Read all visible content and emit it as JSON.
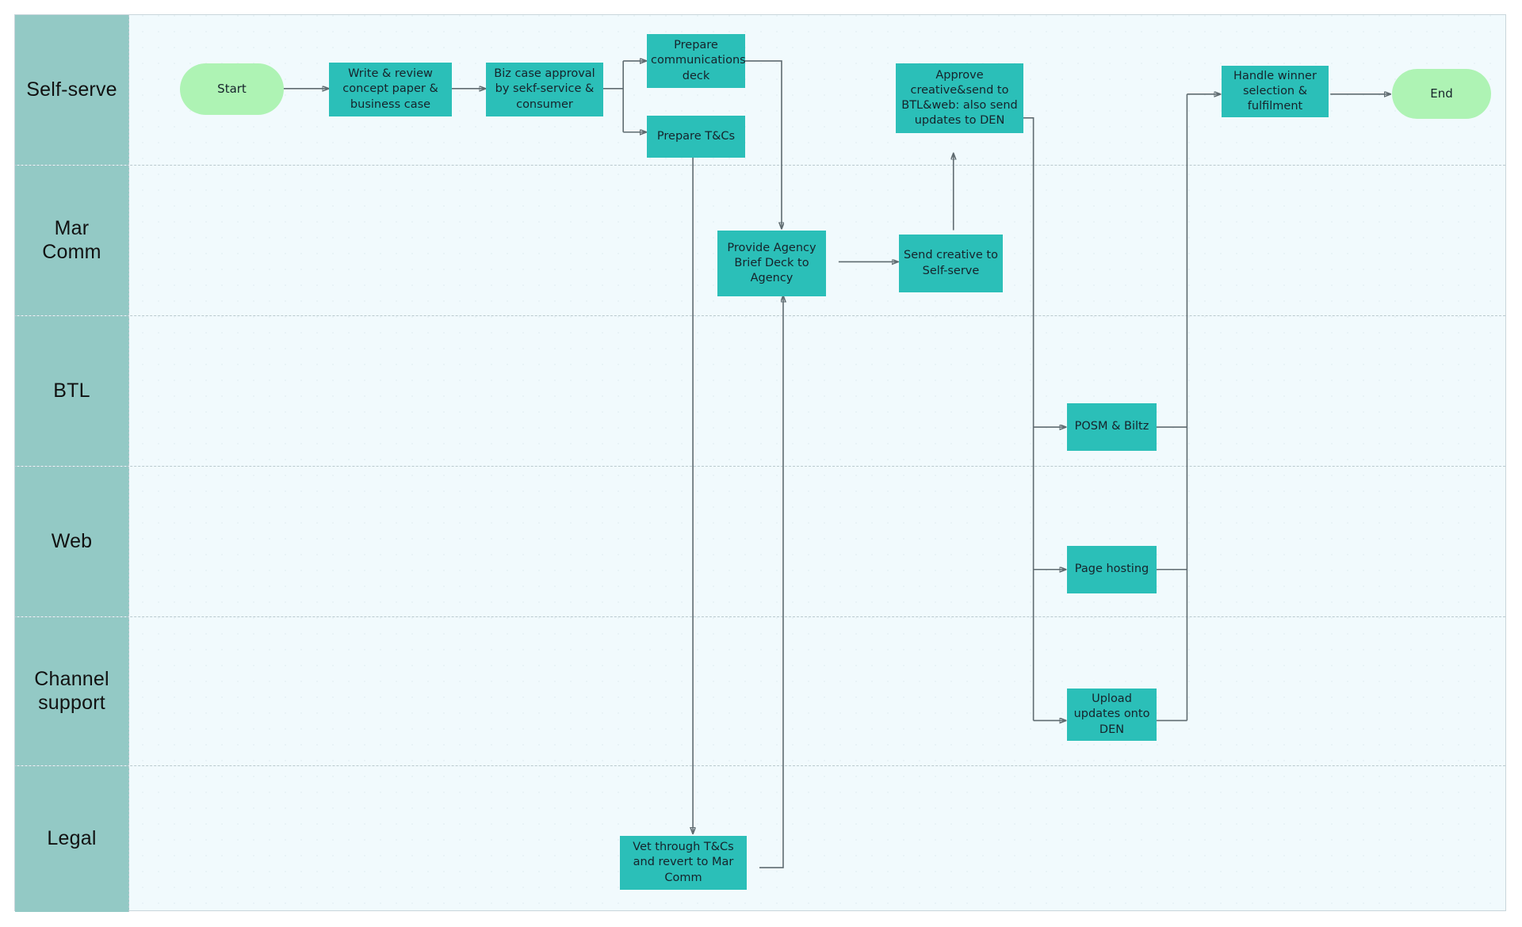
{
  "diagram": {
    "type": "swimlane-flowchart",
    "canvas": {
      "bg": "#f1fafd",
      "border": "#c9d6db"
    },
    "colors": {
      "lane_header": "#93c9c5",
      "process": "#2bbfb8",
      "terminator": "#aef3b4",
      "connector": "#5f6b70",
      "text": "#16232b"
    }
  },
  "lanes": [
    {
      "id": "self-serve",
      "label": "Self-serve"
    },
    {
      "id": "mar-comm",
      "label": "Mar\nComm"
    },
    {
      "id": "btl",
      "label": "BTL"
    },
    {
      "id": "web",
      "label": "Web"
    },
    {
      "id": "channel-support",
      "label": "Channel\nsupport"
    },
    {
      "id": "legal",
      "label": "Legal"
    }
  ],
  "lane_labels": {
    "self_serve": "Self-serve",
    "mar_comm_line1": "Mar",
    "mar_comm_line2": "Comm",
    "btl": "BTL",
    "web": "Web",
    "channel_line1": "Channel",
    "channel_line2": "support",
    "legal": "Legal"
  },
  "nodes": {
    "start": {
      "label": "Start",
      "lane": "self-serve",
      "shape": "terminator"
    },
    "write_review": {
      "label": "Write & review concept paper & business case",
      "lane": "self-serve",
      "shape": "process"
    },
    "biz_case": {
      "label": "Biz case approval by sekf-service & consumer",
      "lane": "self-serve",
      "shape": "process"
    },
    "prepare_comms": {
      "label": "Prepare communications deck",
      "lane": "self-serve",
      "shape": "process"
    },
    "prepare_tcs": {
      "label": "Prepare T&Cs",
      "lane": "self-serve",
      "shape": "process"
    },
    "approve_creative": {
      "label": "Approve creative&send to BTL&web: also send updates to DEN",
      "lane": "self-serve",
      "shape": "process"
    },
    "handle_winner": {
      "label": "Handle winner selection & fulfilment",
      "lane": "self-serve",
      "shape": "process"
    },
    "end": {
      "label": "End",
      "lane": "self-serve",
      "shape": "terminator"
    },
    "agency_brief": {
      "label": "Provide Agency Brief Deck to Agency",
      "lane": "mar-comm",
      "shape": "process"
    },
    "send_creative": {
      "label": "Send creative to Self-serve",
      "lane": "mar-comm",
      "shape": "process"
    },
    "posm": {
      "label": "POSM & Biltz",
      "lane": "btl",
      "shape": "process"
    },
    "page_hosting": {
      "label": "Page hosting",
      "lane": "web",
      "shape": "process"
    },
    "upload_den": {
      "label": "Upload updates onto DEN",
      "lane": "channel-support",
      "shape": "process"
    },
    "vet_tcs": {
      "label": "Vet through T&Cs and revert to Mar Comm",
      "lane": "legal",
      "shape": "process"
    }
  },
  "edges": [
    {
      "from": "start",
      "to": "write_review"
    },
    {
      "from": "write_review",
      "to": "biz_case"
    },
    {
      "from": "biz_case",
      "to": "prepare_comms"
    },
    {
      "from": "biz_case",
      "to": "prepare_tcs"
    },
    {
      "from": "prepare_comms",
      "to": "agency_brief"
    },
    {
      "from": "prepare_tcs",
      "to": "vet_tcs"
    },
    {
      "from": "vet_tcs",
      "to": "agency_brief"
    },
    {
      "from": "agency_brief",
      "to": "send_creative"
    },
    {
      "from": "send_creative",
      "to": "approve_creative"
    },
    {
      "from": "approve_creative",
      "to": "posm"
    },
    {
      "from": "approve_creative",
      "to": "page_hosting"
    },
    {
      "from": "approve_creative",
      "to": "upload_den"
    },
    {
      "from": "posm",
      "to": "handle_winner"
    },
    {
      "from": "page_hosting",
      "to": "handle_winner"
    },
    {
      "from": "upload_den",
      "to": "handle_winner"
    },
    {
      "from": "handle_winner",
      "to": "end"
    }
  ]
}
